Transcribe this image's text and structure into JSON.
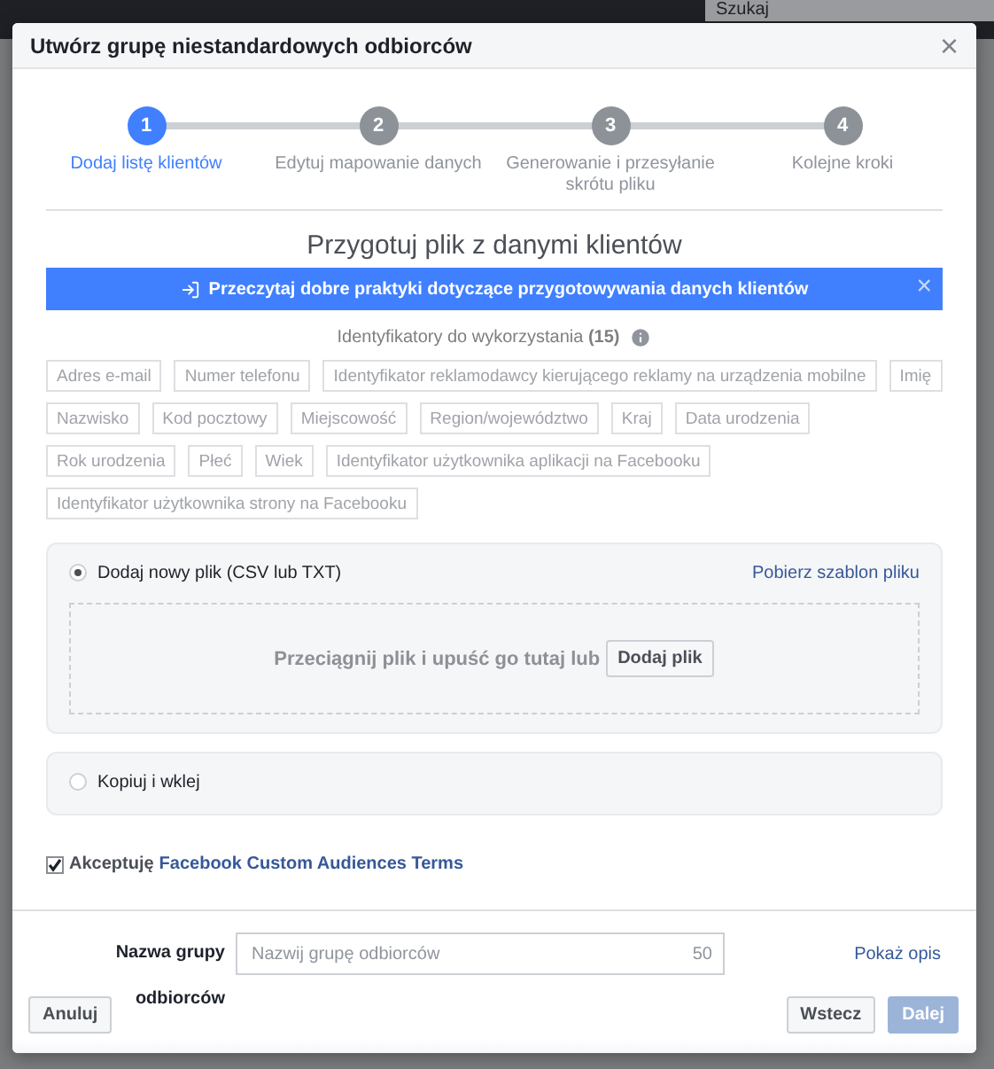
{
  "background": {
    "search_placeholder": "Szukaj"
  },
  "dialog": {
    "title": "Utwórz grupę niestandardowych odbiorców",
    "close": "×"
  },
  "steps": [
    {
      "number": "1",
      "label": "Dodaj listę klientów",
      "selected": true
    },
    {
      "number": "2",
      "label": "Edytuj mapowanie danych",
      "selected": false
    },
    {
      "number": "3",
      "label": "Generowanie i przesyłanie skrótu pliku",
      "selected": false
    },
    {
      "number": "4",
      "label": "Kolejne kroki",
      "selected": false
    }
  ],
  "section_title": "Przygotuj plik z danymi klientów",
  "banner": {
    "text": "Przeczytaj dobre praktyki dotyczące przygotowywania danych klientów",
    "close": "×"
  },
  "identifiers": {
    "label": "Identyfikatory do wykorzystania",
    "count": "(15)",
    "tags": [
      "Adres e-mail",
      "Numer telefonu",
      "Identyfikator reklamodawcy kierującego reklamy na urządzenia mobilne",
      "Imię",
      "Nazwisko",
      "Kod pocztowy",
      "Miejscowość",
      "Region/województwo",
      "Kraj",
      "Data urodzenia",
      "Rok urodzenia",
      "Płeć",
      "Wiek",
      "Identyfikator użytkownika aplikacji na Facebooku",
      "Identyfikator użytkownika strony na Facebooku"
    ]
  },
  "upload_options": [
    {
      "label": "Dodaj nowy plik (CSV lub TXT)",
      "selected": true,
      "link": "Pobierz szablon pliku",
      "dropzone": {
        "text": "Przeciągnij plik i upuść go tutaj lub",
        "button": "Dodaj plik"
      }
    },
    {
      "label": "Kopiuj i wklej",
      "selected": false
    }
  ],
  "terms": {
    "checked": true,
    "text": "Akceptuję",
    "link": "Facebook Custom Audiences Terms"
  },
  "footer": {
    "name_label": "Nazwa grupy odbiorców",
    "placeholder": "Nazwij grupę odbiorców",
    "counter": "50",
    "show_description": "Pokaż opis",
    "buttons": [
      {
        "label": "Anuluj",
        "kind": "cancel",
        "disabled": false
      },
      {
        "label": "Wstecz",
        "kind": "back",
        "disabled": false
      },
      {
        "label": "Dalej",
        "kind": "next",
        "disabled": true
      }
    ]
  }
}
